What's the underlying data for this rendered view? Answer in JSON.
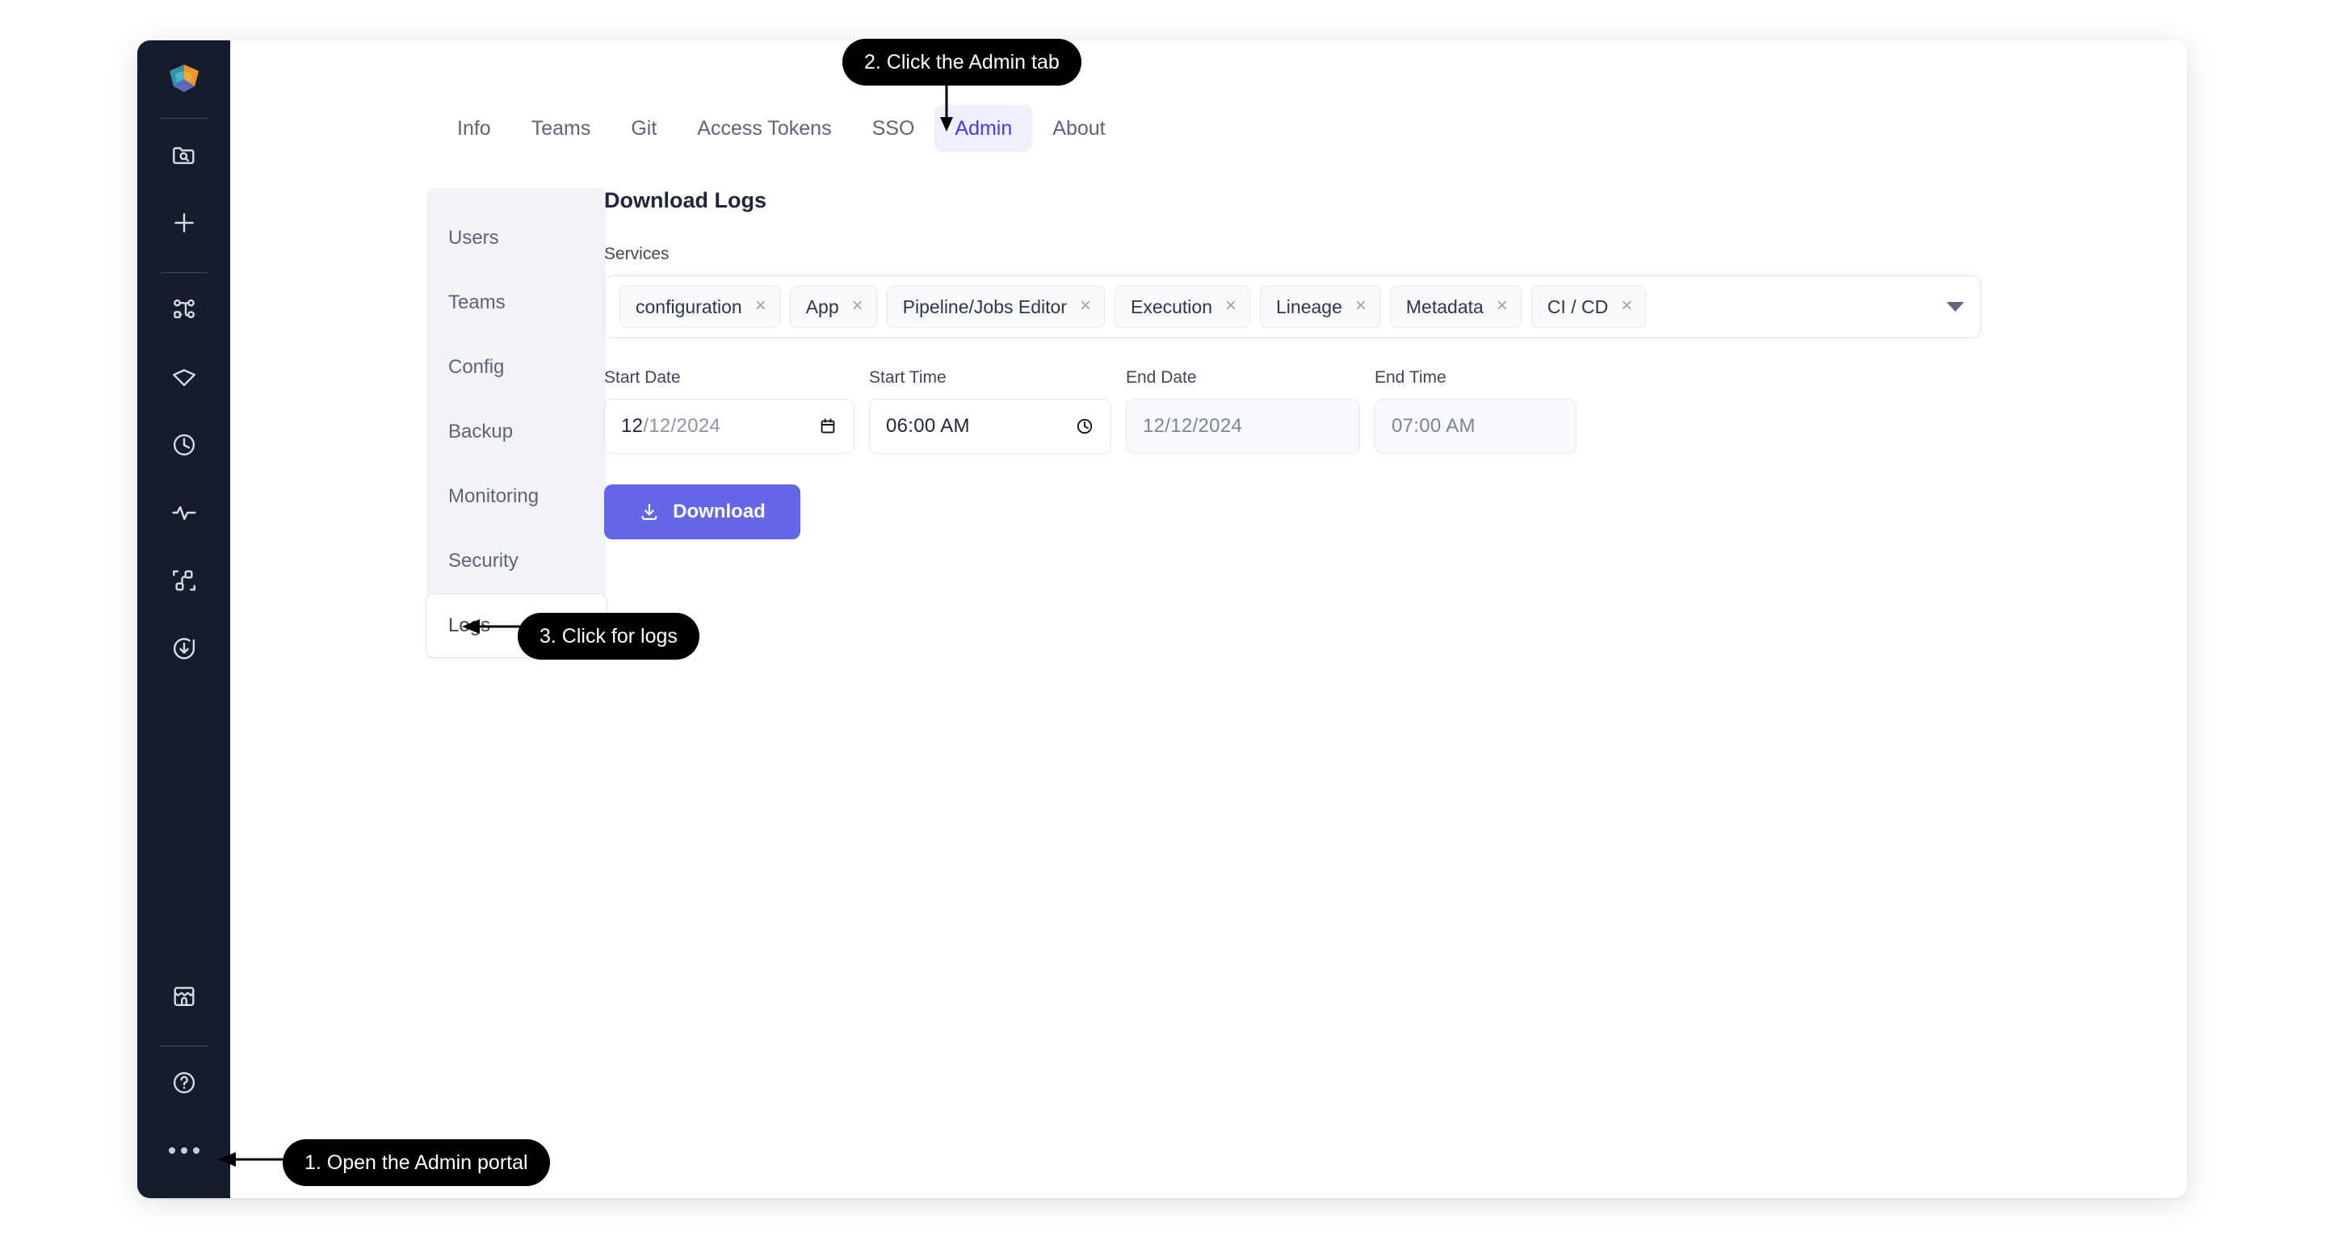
{
  "app": {
    "logo_icon": "prism-cube-logo"
  },
  "rail": {
    "items": [
      {
        "name": "search-folder-icon",
        "label": "Browse"
      },
      {
        "name": "plus-icon",
        "label": "New"
      },
      {
        "name": "pipeline-graph-icon",
        "label": "Pipelines"
      },
      {
        "name": "gem-icon",
        "label": "Assets"
      },
      {
        "name": "clock-icon",
        "label": "History"
      },
      {
        "name": "activity-pulse-icon",
        "label": "Monitoring"
      },
      {
        "name": "node-connections-icon",
        "label": "Lineage"
      },
      {
        "name": "download-circle-icon",
        "label": "Downloads"
      }
    ],
    "bottom_items": [
      {
        "name": "marketplace-store-icon",
        "label": "Marketplace"
      },
      {
        "name": "help-circle-icon",
        "label": "Help"
      },
      {
        "name": "more-dots-icon",
        "label": "More"
      }
    ]
  },
  "tabs": [
    {
      "label": "Info",
      "active": false
    },
    {
      "label": "Teams",
      "active": false
    },
    {
      "label": "Git",
      "active": false
    },
    {
      "label": "Access Tokens",
      "active": false
    },
    {
      "label": "SSO",
      "active": false
    },
    {
      "label": "Admin",
      "active": true
    },
    {
      "label": "About",
      "active": false
    }
  ],
  "settings_menu": {
    "items": [
      {
        "label": "Users",
        "selected": false
      },
      {
        "label": "Teams",
        "selected": false
      },
      {
        "label": "Config",
        "selected": false
      },
      {
        "label": "Backup",
        "selected": false
      },
      {
        "label": "Monitoring",
        "selected": false
      },
      {
        "label": "Security",
        "selected": false
      },
      {
        "label": "Logs",
        "selected": true
      }
    ]
  },
  "panel": {
    "title": "Download Logs",
    "services": {
      "label": "Services",
      "chips": [
        "configuration",
        "App",
        "Pipeline/Jobs Editor",
        "Execution",
        "Lineage",
        "Metadata",
        "CI / CD"
      ],
      "remove_glyph": "×",
      "caret_icon": "chevron-down-icon"
    },
    "start_date": {
      "label": "Start Date",
      "value_month": "12",
      "value_rest": "/12/2024",
      "value": "12/12/2024",
      "icon": "calendar-icon"
    },
    "start_time": {
      "label": "Start Time",
      "value": "06:00 AM",
      "icon": "clock-icon"
    },
    "end_date": {
      "label": "End Date",
      "value": "12/12/2024",
      "disabled": true
    },
    "end_time": {
      "label": "End Time",
      "value": "07:00 AM",
      "disabled": true
    },
    "download_button": {
      "label": "Download",
      "icon": "download-icon",
      "color": "#6366e8"
    }
  },
  "callouts": [
    {
      "id": 1,
      "text": "1. Open the Admin portal"
    },
    {
      "id": 2,
      "text": "2. Click the Admin tab"
    },
    {
      "id": 3,
      "text": "3. Click for logs"
    }
  ],
  "colors": {
    "accent": "#6366e8",
    "tab_active_bg": "#eef0fe",
    "tab_active_text": "#4338f5",
    "rail_bg": "#141c2e",
    "menu_bg": "#f1f3f7"
  }
}
